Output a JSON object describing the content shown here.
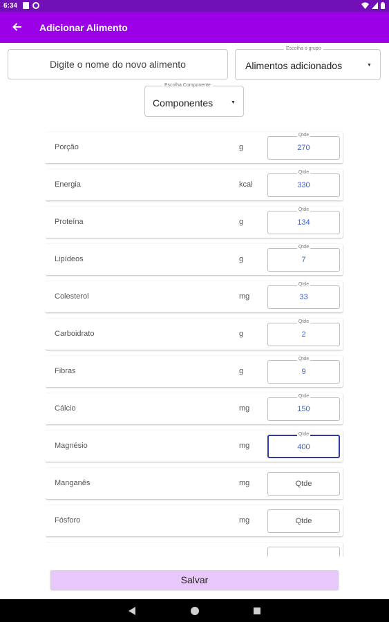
{
  "status_bar": {
    "time": "6:34"
  },
  "app_bar": {
    "title": "Adicionar Alimento",
    "back_icon": "arrow-left-icon"
  },
  "form": {
    "name_placeholder": "Digite o nome do novo alimento",
    "group_select": {
      "legend": "Escolha o grupo",
      "value": "Alimentos adicionados"
    },
    "component_select": {
      "legend": "Escolha Componente",
      "value": "Componentes"
    }
  },
  "qty_label": "Qtde",
  "nutrients": [
    {
      "name": "Porção",
      "unit": "g",
      "value": "270"
    },
    {
      "name": "Energia",
      "unit": "kcal",
      "value": "330"
    },
    {
      "name": "Proteína",
      "unit": "g",
      "value": "134"
    },
    {
      "name": "Lipídeos",
      "unit": "g",
      "value": "7"
    },
    {
      "name": "Colesterol",
      "unit": "mg",
      "value": "33"
    },
    {
      "name": "Carboidrato",
      "unit": "g",
      "value": "2"
    },
    {
      "name": "Fibras",
      "unit": "g",
      "value": "9"
    },
    {
      "name": "Cálcio",
      "unit": "mg",
      "value": "150"
    },
    {
      "name": "Magnésio",
      "unit": "mg",
      "value": "400"
    },
    {
      "name": "Manganês",
      "unit": "mg",
      "value": ""
    },
    {
      "name": "Fósforo",
      "unit": "mg",
      "value": ""
    },
    {
      "name": "",
      "unit": "",
      "value": ""
    }
  ],
  "focused_index": 8,
  "save_button": "Salvar"
}
